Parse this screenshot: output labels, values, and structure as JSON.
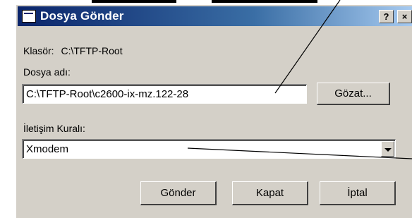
{
  "window": {
    "title": "Dosya Gönder",
    "help_label": "?",
    "close_label": "×"
  },
  "folder": {
    "label": "Klasör:",
    "value": "C:\\TFTP-Root"
  },
  "filename": {
    "label": "Dosya adı:",
    "value": "C:\\TFTP-Root\\c2600-ix-mz.122-28"
  },
  "browse_label": "Gözat...",
  "protocol": {
    "label": "İletişim Kuralı:",
    "value": "Xmodem"
  },
  "buttons": {
    "send": "Gönder",
    "close": "Kapat",
    "cancel": "İptal"
  }
}
